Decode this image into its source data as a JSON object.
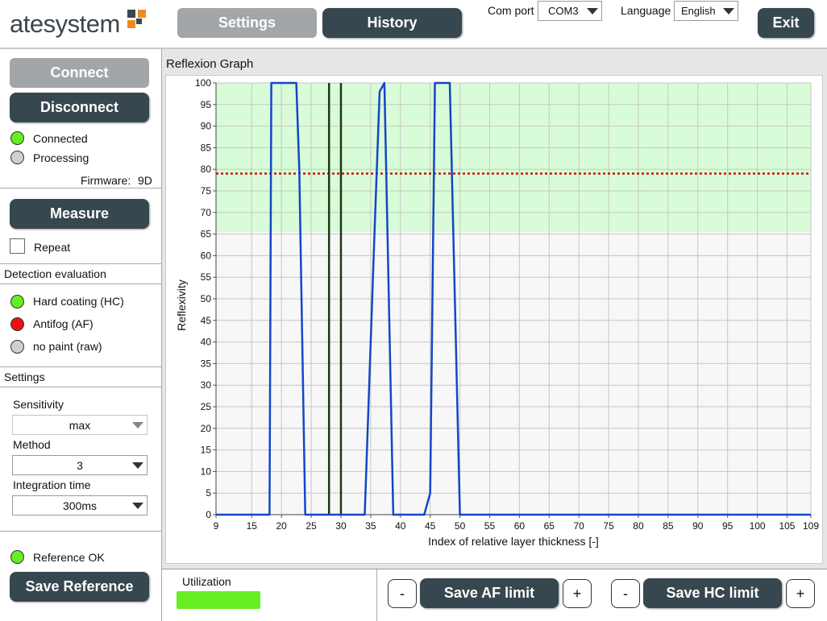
{
  "header": {
    "logo_text": "atesystem",
    "tabs": [
      {
        "label": "Settings",
        "active": true
      },
      {
        "label": "History",
        "active": false
      }
    ],
    "com_port_label": "Com port",
    "com_port_value": "COM3",
    "language_label": "Language",
    "language_value": "English",
    "exit_label": "Exit"
  },
  "sidebar": {
    "connect_label": "Connect",
    "disconnect_label": "Disconnect",
    "status": [
      {
        "label": "Connected",
        "color": "green"
      },
      {
        "label": "Processing",
        "color": "gray"
      }
    ],
    "firmware_label": "Firmware:",
    "firmware_value": "9D",
    "measure_label": "Measure",
    "repeat_label": "Repeat",
    "repeat_checked": false,
    "detection_title": "Detection evaluation",
    "detection": [
      {
        "label": "Hard coating (HC)",
        "color": "green"
      },
      {
        "label": "Antifog (AF)",
        "color": "red"
      },
      {
        "label": "no paint (raw)",
        "color": "gray"
      }
    ],
    "settings_title": "Settings",
    "sensitivity_label": "Sensitivity",
    "sensitivity_value": "max",
    "method_label": "Method",
    "method_value": "3",
    "integration_label": "Integration time",
    "integration_value": "300ms",
    "reference_label": "Reference OK",
    "save_reference_label": "Save Reference"
  },
  "graph": {
    "panel_title": "Reflexion Graph"
  },
  "footer": {
    "utilization_label": "Utilization",
    "utilization_fraction": 1.0,
    "minus_label": "-",
    "plus_label": "+",
    "save_af_label": "Save AF limit",
    "save_hc_label": "Save HC limit"
  },
  "colors": {
    "accent_dark": "#37474f",
    "disabled": "#a2a6a8",
    "led_green": "#66ee22",
    "led_red": "#ee1111",
    "zone_fill": "#d8fcd8",
    "curve": "#1446c8",
    "threshold": "#cc1111",
    "markers": "#1e3a0e"
  },
  "chart_data": {
    "type": "line",
    "xlabel": "Index of relative layer thickness [-]",
    "ylabel": "Reflexivity",
    "xlim": [
      9,
      109
    ],
    "ylim": [
      0,
      100
    ],
    "x_ticks": [
      9,
      15,
      20,
      25,
      30,
      35,
      40,
      45,
      50,
      55,
      60,
      65,
      70,
      75,
      80,
      85,
      90,
      95,
      100,
      105,
      109
    ],
    "y_ticks": [
      0,
      5,
      10,
      15,
      20,
      25,
      30,
      35,
      40,
      45,
      50,
      55,
      60,
      65,
      70,
      75,
      80,
      85,
      90,
      95,
      100
    ],
    "grid": true,
    "highlight_band": {
      "from": 65.5,
      "to": 100
    },
    "threshold_y": 79,
    "vertical_markers": [
      28,
      30
    ],
    "series": [
      {
        "x": [
          9,
          18,
          18.3,
          22.5,
          23,
          24,
          34,
          35.5,
          36.5,
          37.3,
          38.8,
          44,
          45,
          45.8,
          48.3,
          50,
          109
        ],
        "y": [
          0,
          0,
          100,
          100,
          80,
          0,
          0,
          60,
          98,
          100,
          0,
          0,
          5,
          100,
          100,
          0,
          0
        ]
      }
    ]
  }
}
